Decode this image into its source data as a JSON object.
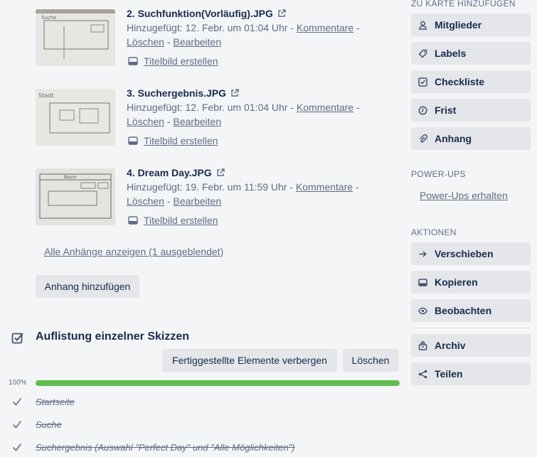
{
  "attachments": [
    {
      "title": "2. Suchfunktion(Vorläufig).JPG",
      "added": "Hinzugefügt: 12. Febr. um 01:04 Uhr",
      "comment": "Kommentare",
      "delete": "Löschen",
      "edit": "Bearbeiten",
      "cover": "Titelbild erstellen"
    },
    {
      "title": "3. Suchergebnis.JPG",
      "added": "Hinzugefügt: 12. Febr. um 01:04 Uhr",
      "comment": "Kommentare",
      "delete": "Löschen",
      "edit": "Bearbeiten",
      "cover": "Titelbild erstellen"
    },
    {
      "title": "4. Dream Day.JPG",
      "added": "Hinzugefügt: 19. Febr. um 11:59 Uhr",
      "comment": "Kommentare",
      "delete": "Löschen",
      "edit": "Bearbeiten",
      "cover": "Titelbild erstellen"
    }
  ],
  "show_all": "Alle Anhänge anzeigen (1 ausgeblendet)",
  "add_attachment": "Anhang hinzufügen",
  "checklist": {
    "title": "Auflistung einzelner Skizzen",
    "hide_done": "Fertiggestellte Elemente verbergen",
    "delete": "Löschen",
    "progress_label": "100%",
    "progress": 1.0,
    "items": [
      "Startseite",
      "Suche",
      "Suchergebnis (Auswahl \"Perfect Day\" und \"Alle Möglichkeiten\")"
    ]
  },
  "sidebar": {
    "add_heading": "ZU KARTE HINZUFÜGEN",
    "add_buttons": [
      {
        "label": "Mitglieder",
        "icon": "person-icon"
      },
      {
        "label": "Labels",
        "icon": "tag-icon"
      },
      {
        "label": "Checkliste",
        "icon": "checkbox-icon"
      },
      {
        "label": "Frist",
        "icon": "clock-icon"
      },
      {
        "label": "Anhang",
        "icon": "paperclip-icon"
      }
    ],
    "powerups_heading": "POWER-UPS",
    "powerups_link": "Power-Ups erhalten",
    "actions_heading": "AKTIONEN",
    "actions": [
      {
        "label": "Verschieben",
        "icon": "arrow-right-icon"
      },
      {
        "label": "Kopieren",
        "icon": "card-icon"
      },
      {
        "label": "Beobachten",
        "icon": "eye-icon"
      },
      {
        "label": "Archiv",
        "icon": "archive-icon"
      },
      {
        "label": "Teilen",
        "icon": "share-icon"
      }
    ]
  },
  "colors": {
    "progress": "#61bd4f",
    "button": "#e4e6ea",
    "text_dark": "#172b4d",
    "text_muted": "#5e6c84"
  }
}
